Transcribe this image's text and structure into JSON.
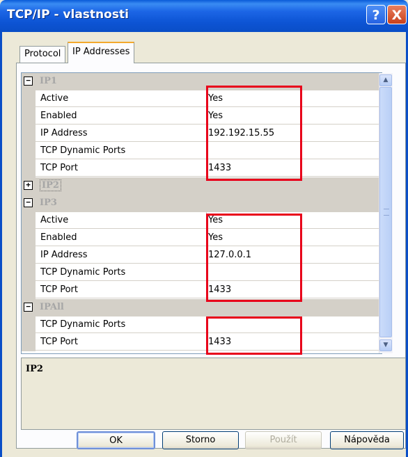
{
  "window": {
    "title": "TCP/IP - vlastnosti",
    "help_symbol": "?",
    "close_symbol": "X"
  },
  "tabs": [
    {
      "label": "Protocol"
    },
    {
      "label": "IP Addresses"
    }
  ],
  "groups": [
    {
      "label": "IP1",
      "toggle": "−",
      "expanded": true,
      "props": [
        {
          "name": "Active",
          "value": "Yes"
        },
        {
          "name": "Enabled",
          "value": "Yes"
        },
        {
          "name": "IP Address",
          "value": "192.192.15.55"
        },
        {
          "name": "TCP Dynamic Ports",
          "value": ""
        },
        {
          "name": "TCP Port",
          "value": "1433"
        }
      ]
    },
    {
      "label": "IP2",
      "toggle": "+",
      "expanded": false,
      "props": []
    },
    {
      "label": "IP3",
      "toggle": "−",
      "expanded": true,
      "props": [
        {
          "name": "Active",
          "value": "Yes"
        },
        {
          "name": "Enabled",
          "value": "Yes"
        },
        {
          "name": "IP Address",
          "value": "127.0.0.1"
        },
        {
          "name": "TCP Dynamic Ports",
          "value": ""
        },
        {
          "name": "TCP Port",
          "value": "1433"
        }
      ]
    },
    {
      "label": "IPAll",
      "toggle": "−",
      "expanded": true,
      "props": [
        {
          "name": "TCP Dynamic Ports",
          "value": ""
        },
        {
          "name": "TCP Port",
          "value": "1433"
        }
      ]
    }
  ],
  "description": {
    "title": "IP2"
  },
  "buttons": {
    "ok": "OK",
    "storno": "Storno",
    "pouzit": "Použít",
    "napoveda": "Nápověda"
  },
  "colors": {
    "highlight_box": "#e8001a",
    "titlebar": "#0a4ec7"
  },
  "icons": {
    "scroll_up": "▲",
    "scroll_down": "▼"
  }
}
